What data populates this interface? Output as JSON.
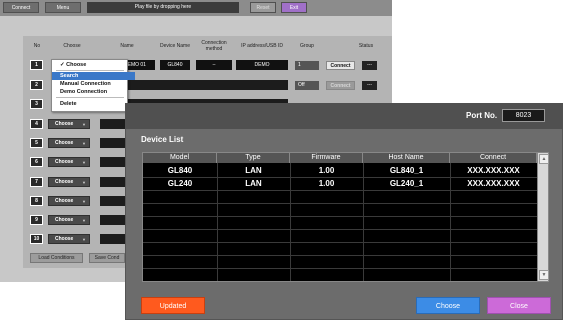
{
  "topbar": {
    "connect_label": "Connect",
    "menu_label": "Menu",
    "message": "Play file by dropping here",
    "reset_label": "Reset",
    "exit_label": "Exit"
  },
  "table_header": {
    "no": "No",
    "choose": "Choose",
    "name": "Name",
    "device_name": "Device Name",
    "connection_method": "Connection method",
    "ip": "IP address/USB ID",
    "group": "Group",
    "status": "Status"
  },
  "rows": [
    {
      "no": "1",
      "choose": "Choose",
      "name": "DEMO 01",
      "device": "GL840",
      "method": "–",
      "ip": "DEMO",
      "group": "1",
      "connect": "Connect",
      "status": "---"
    },
    {
      "no": "2",
      "choose": "Choose",
      "group": "Off",
      "connect": "Connect",
      "status": "---"
    },
    {
      "no": "3",
      "choose": "Choose"
    },
    {
      "no": "4",
      "choose": "Choose"
    },
    {
      "no": "5",
      "choose": "Choose"
    },
    {
      "no": "6",
      "choose": "Choose"
    },
    {
      "no": "7",
      "choose": "Choose"
    },
    {
      "no": "8",
      "choose": "Choose"
    },
    {
      "no": "9",
      "choose": "Choose"
    },
    {
      "no": "10",
      "choose": "Choose"
    }
  ],
  "bottom": {
    "load": "Load Conditions",
    "save": "Save Cond"
  },
  "dropdown": {
    "items": [
      "✓ Choose",
      "Search",
      "Manual Connection",
      "Demo Connection",
      "Delete"
    ],
    "selected": "Search"
  },
  "dialog": {
    "port_label": "Port No.",
    "port_value": "8023",
    "title": "Device List",
    "columns": [
      "Model",
      "Type",
      "Firmware",
      "Host Name",
      "Connect"
    ],
    "devices": [
      {
        "model": "GL840",
        "type": "LAN",
        "firmware": "1.00",
        "host": "GL840_1",
        "connect": "XXX.XXX.XXX"
      },
      {
        "model": "GL240",
        "type": "LAN",
        "firmware": "1.00",
        "host": "GL240_1",
        "connect": "XXX.XXX.XXX"
      }
    ],
    "updated_label": "Updated",
    "choose_label": "Choose",
    "close_label": "Close"
  },
  "colors": {
    "updated": "#ff5a1e",
    "choose": "#3c8ce6",
    "close": "#cc6ad8",
    "exit": "#a070c8",
    "selection": "#3a78c8"
  },
  "icons": [
    "check-icon",
    "chevron-down-icon",
    "scroll-up-arrow-icon",
    "scroll-down-arrow-icon"
  ]
}
